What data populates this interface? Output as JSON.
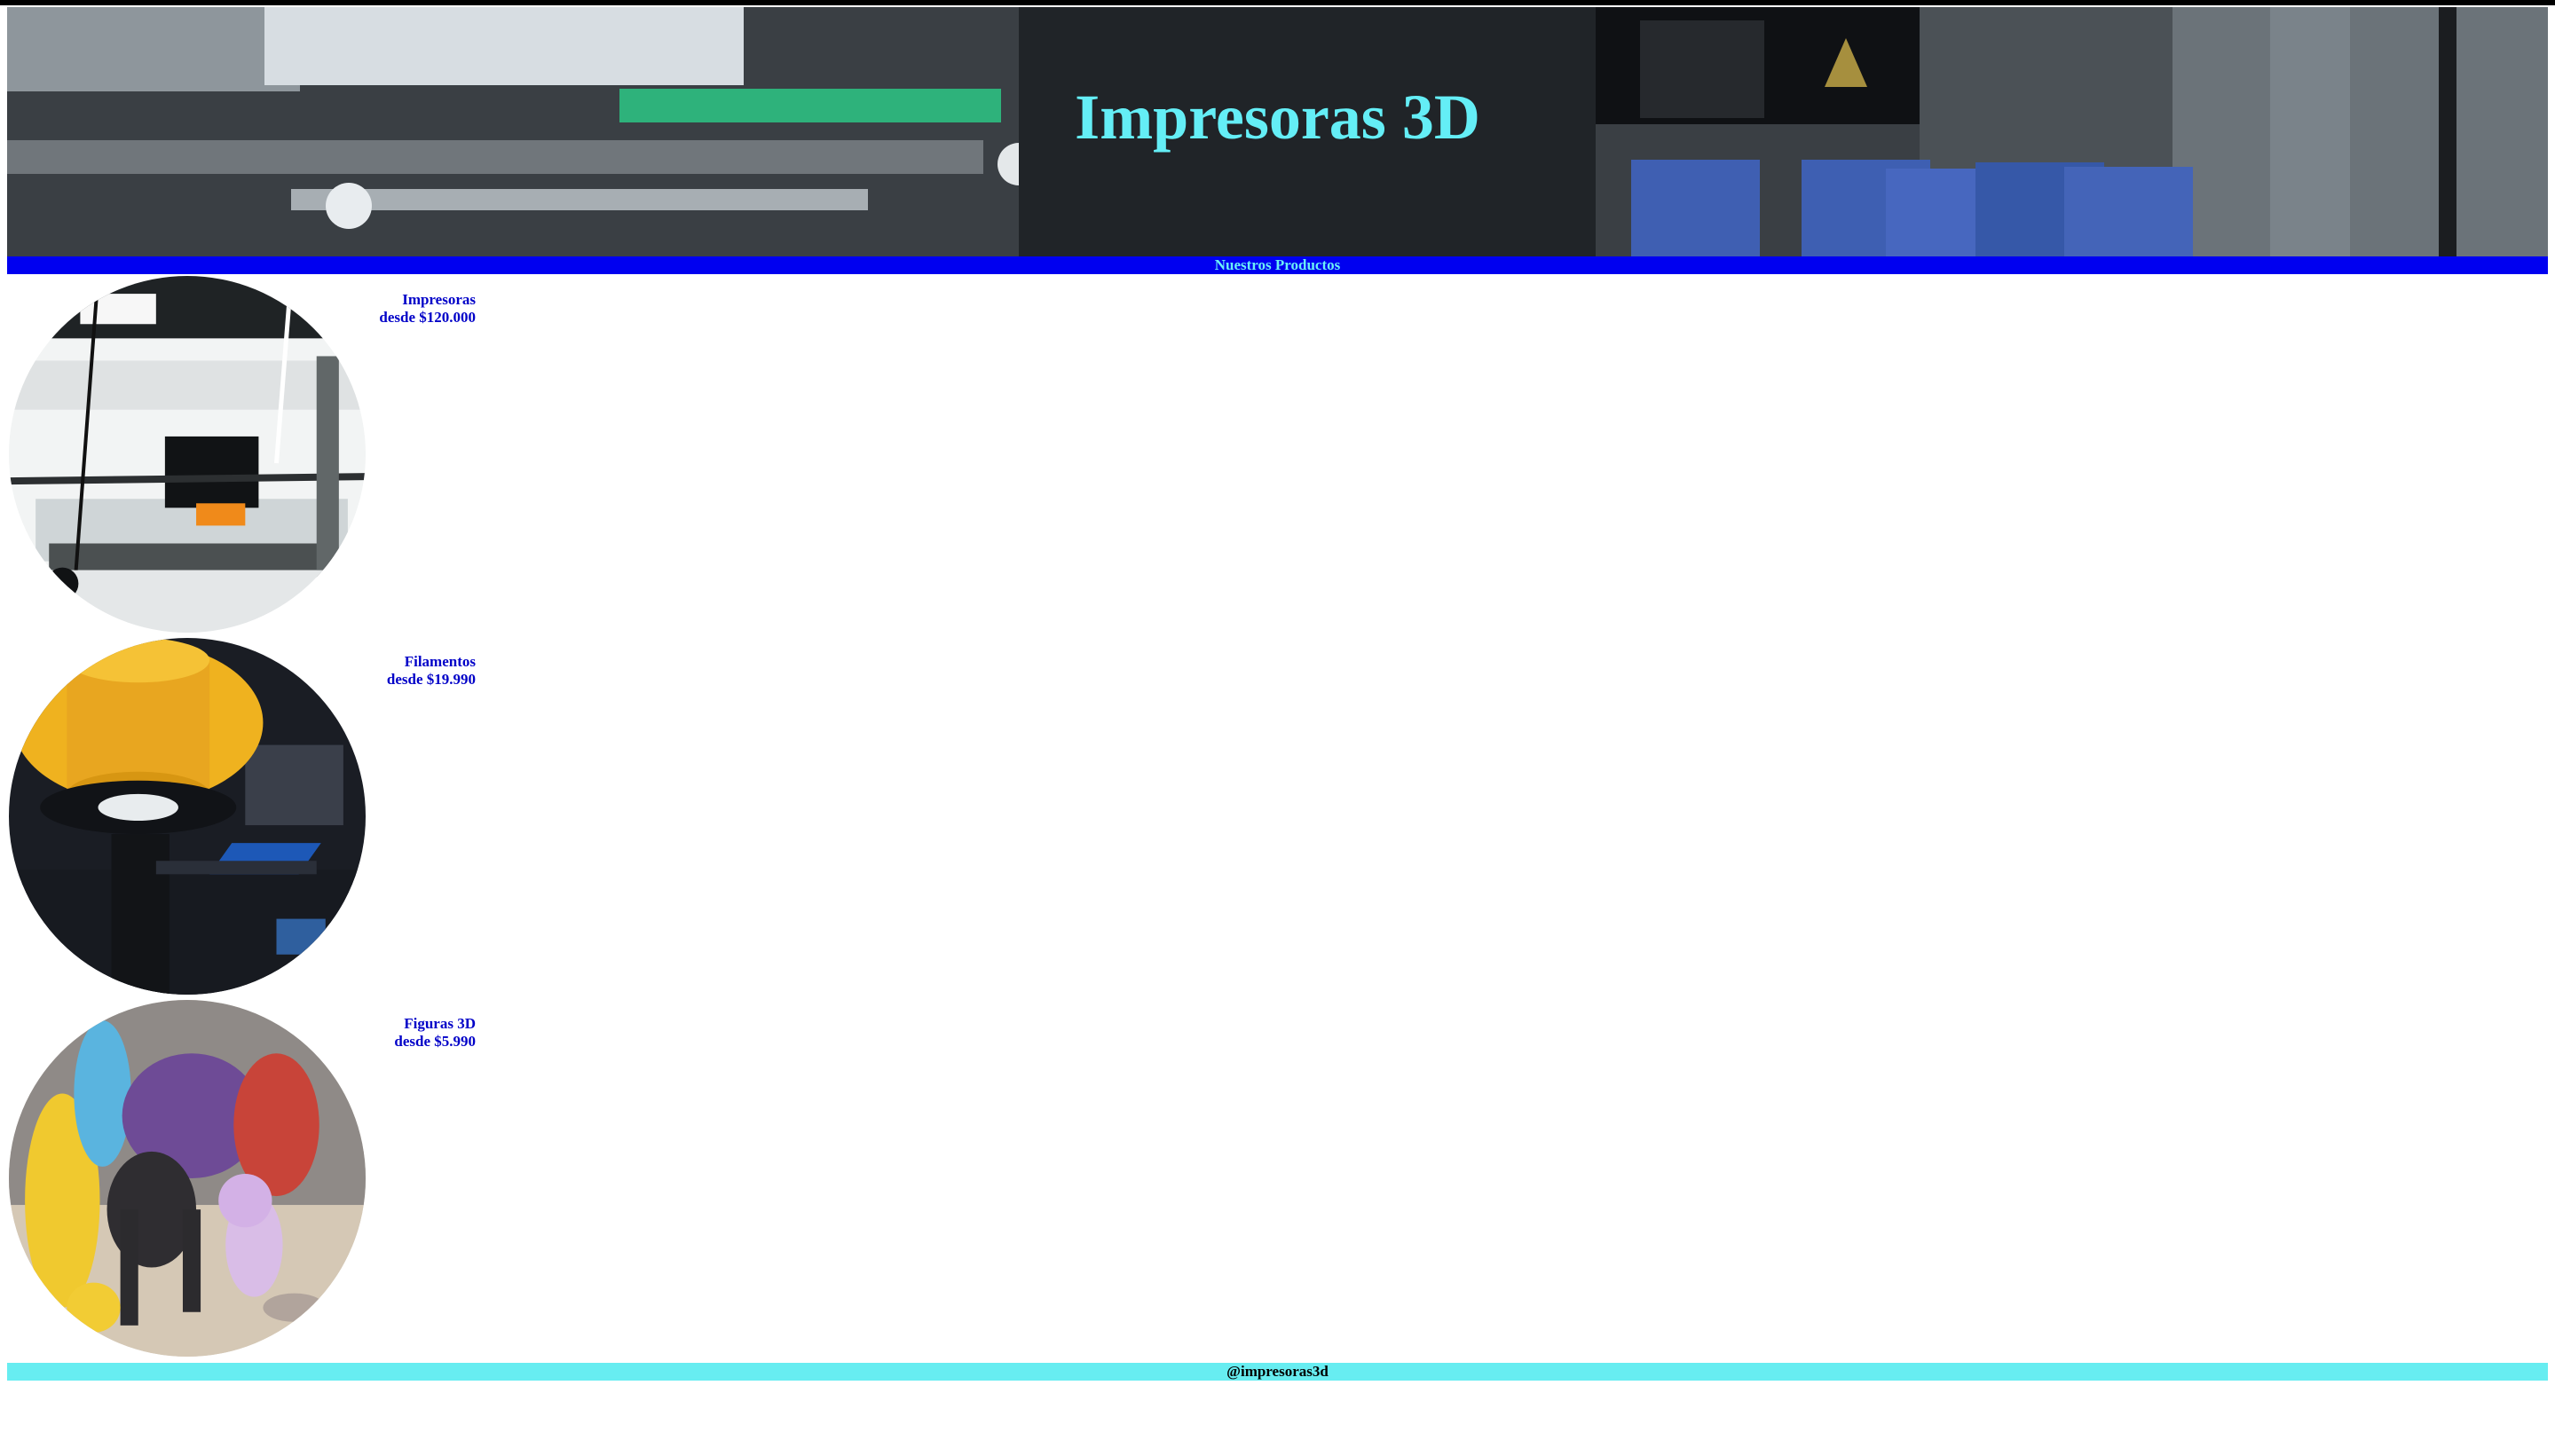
{
  "header": {
    "title": "Impresoras 3D"
  },
  "nav": {
    "label": "Nuestros Productos"
  },
  "products": [
    {
      "name": "Impresoras",
      "price": "desde $120.000",
      "image_icon": "3d-printer-photo"
    },
    {
      "name": "Filamentos",
      "price": "desde $19.990",
      "image_icon": "filament-spool-photo"
    },
    {
      "name": "Figuras 3D",
      "price": "desde $5.990",
      "image_icon": "3d-figures-photo"
    }
  ],
  "footer": {
    "handle": "@impresoras3d"
  },
  "colors": {
    "title": "#64eef6",
    "nav_background": "#0000f0",
    "nav_text": "#6af0f7",
    "product_text": "#0000c8",
    "footer_background": "#67edf1"
  }
}
